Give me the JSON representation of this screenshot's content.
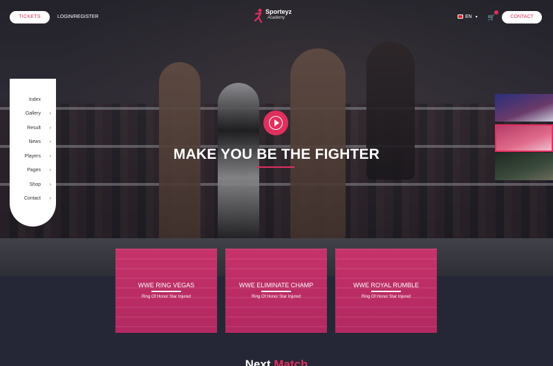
{
  "header": {
    "tickets_label": "TICKETS",
    "login_label": "LOGIN/REGISTER",
    "logo_name": "Sporteyz",
    "logo_sub": "Academy",
    "language": "EN",
    "language_caret": "▾",
    "cart_icon": "🛒",
    "contact_label": "CONTACT"
  },
  "sidebar": {
    "items": [
      {
        "label": "Index",
        "chevron": ""
      },
      {
        "label": "Gallery",
        "chevron": "›"
      },
      {
        "label": "Result",
        "chevron": "›"
      },
      {
        "label": "News",
        "chevron": "›"
      },
      {
        "label": "Players",
        "chevron": "›"
      },
      {
        "label": "Pages",
        "chevron": "›"
      },
      {
        "label": "Shop",
        "chevron": "›"
      },
      {
        "label": "Contact",
        "chevron": "›"
      }
    ]
  },
  "hero": {
    "title": "MAKE YOU BE THE FIGHTER"
  },
  "cards": [
    {
      "title": "WWE RING VEGAS",
      "subtitle": "Ring Of Honor Star Injured"
    },
    {
      "title": "WWE ELIMINATE CHAMP",
      "subtitle": "Ring Of Honor Star Injured"
    },
    {
      "title": "WWE ROYAL RUMBLE",
      "subtitle": "Ring Of Honor Star Injured"
    }
  ],
  "next_section": {
    "word1": "Next",
    "word2": "Match"
  },
  "colors": {
    "accent": "#e0305e",
    "background": "#262736"
  }
}
